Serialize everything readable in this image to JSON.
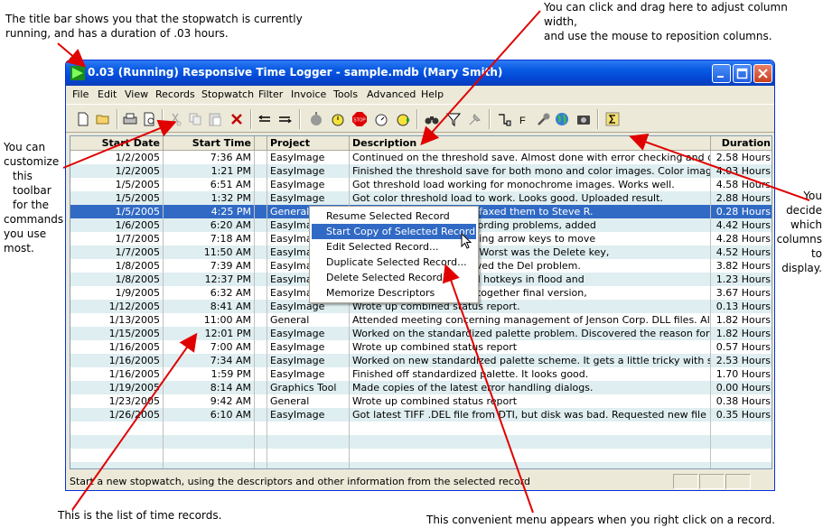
{
  "callouts": {
    "title_bar": [
      "The title bar shows you that the stopwatch is currently",
      "running, and has a duration of .03 hours."
    ],
    "columns_drag": [
      "You can click and drag here to adjust column width,",
      "and use the mouse to reposition columns."
    ],
    "toolbar": [
      "You can",
      "customize",
      "this",
      "toolbar",
      "for the",
      "commands",
      "you use",
      "most."
    ],
    "columns_display": [
      "You",
      "decide",
      "which",
      "columns",
      "to",
      "display."
    ],
    "list": "This is the list of time records.",
    "menu": "This convenient menu appears when you right click on a record."
  },
  "window": {
    "title": "0.03 (Running) Responsive Time Logger - sample.mdb (Mary Smith)"
  },
  "menu": [
    "File",
    "Edit",
    "View",
    "Records",
    "Stopwatch",
    "Filter",
    "Invoice",
    "Tools",
    "Advanced",
    "Help"
  ],
  "columns": [
    "Start Date",
    "Start Time",
    "Project",
    "Description",
    "Duration"
  ],
  "rows": [
    {
      "date": "1/2/2005",
      "time": "7:36 AM",
      "project": "EasyImage",
      "desc": "Continued on the threshold save.  Almost done with error checking and dialog",
      "dur": "2.58 Hours"
    },
    {
      "date": "1/2/2005",
      "time": "1:21 PM",
      "project": "EasyImage",
      "desc": "Finished the threshold save for both mono and color images.  Color image stuff",
      "dur": "4.03 Hours"
    },
    {
      "date": "1/5/2005",
      "time": "6:51 AM",
      "project": "EasyImage",
      "desc": "Got threshold load working for monochrome images.  Works well.",
      "dur": "4.58 Hours"
    },
    {
      "date": "1/5/2005",
      "time": "1:32 PM",
      "project": "EasyImage",
      "desc": "Got color threshold load to work.  Looks good.  Uploaded result.",
      "dur": "2.88 Hours"
    },
    {
      "date": "1/5/2005",
      "time": "4:25 PM",
      "project": "General",
      "desc": "ments on error handling, faxed them to Steve R.",
      "dur": "0.28 Hours"
    },
    {
      "date": "1/6/2005",
      "time": "6:20 AM",
      "project": "EasyImag",
      "desc": "changes, fixed macro recording problems, added",
      "dur": "4.42 Hours"
    },
    {
      "date": "1/7/2005",
      "time": "7:18 AM",
      "project": "EasyImag",
      "desc": "s for keyboard mouse: Using arrow keys to move",
      "dur": "4.28 Hours"
    },
    {
      "date": "1/7/2005",
      "time": "11:50 AM",
      "project": "EasyImag",
      "desc": "yboard mouse problems.  Worst was the Delete key,",
      "dur": "4.52 Hours"
    },
    {
      "date": "1/8/2005",
      "time": "7:39 AM",
      "project": "EasyImag",
      "desc": "problem.  Still haven't solved the Del problem.",
      "dur": "3.82 Hours"
    },
    {
      "date": "1/8/2005",
      "time": "12:37 PM",
      "project": "EasyImag",
      "desc": "mouse presence.  Modifed hotkeys in flood and",
      "dur": "1.23 Hours"
    },
    {
      "date": "1/9/2005",
      "time": "6:32 AM",
      "project": "EasyImag",
      "desc": "board mouse issues.  Put together final version,",
      "dur": "3.67 Hours"
    },
    {
      "date": "1/12/2005",
      "time": "8:41 AM",
      "project": "EasyImage",
      "desc": "Wrote up combined status report.",
      "dur": "0.13 Hours"
    },
    {
      "date": "1/13/2005",
      "time": "11:00 AM",
      "project": "General",
      "desc": "Attended meeting concerning management of Jenson Corp. DLL files.  Also",
      "dur": "1.82 Hours"
    },
    {
      "date": "1/15/2005",
      "time": "12:01 PM",
      "project": "EasyImage",
      "desc": "Worked on the standardized palette problem.  Discovered the reason for it,",
      "dur": "1.82 Hours"
    },
    {
      "date": "1/16/2005",
      "time": "7:00 AM",
      "project": "EasyImage",
      "desc": "Wrote up combined status report",
      "dur": "0.57 Hours"
    },
    {
      "date": "1/16/2005",
      "time": "7:34 AM",
      "project": "EasyImage",
      "desc": "Worked on new standardized palette scheme.  It gets a little tricky with several",
      "dur": "2.53 Hours"
    },
    {
      "date": "1/16/2005",
      "time": "1:59 PM",
      "project": "EasyImage",
      "desc": "Finished off standardized palette.  It looks good.",
      "dur": "1.70 Hours"
    },
    {
      "date": "1/19/2005",
      "time": "8:14 AM",
      "project": "Graphics Tool",
      "desc": "Made copies of the latest error handling dialogs.",
      "dur": "0.00 Hours"
    },
    {
      "date": "1/23/2005",
      "time": "9:42 AM",
      "project": "General",
      "desc": "Wrote up combined status report",
      "dur": "0.38 Hours"
    },
    {
      "date": "1/26/2005",
      "time": "6:10 AM",
      "project": "EasyImage",
      "desc": "Got latest TIFF .DEL file from DTI, but disk was bad.  Requested new file via BBS.",
      "dur": "0.35 Hours"
    }
  ],
  "context_menu": [
    "Resume Selected Record",
    "Start Copy of Selected Record",
    "Edit Selected Record...",
    "Duplicate Selected Record...",
    "Delete Selected Record",
    "Memorize Descriptors"
  ],
  "status": "Start a new stopwatch, using the descriptors and other information from the selected record",
  "icons": [
    "new-icon",
    "open-icon",
    "print-icon",
    "print-preview-icon",
    "cut-icon",
    "copy-icon",
    "paste-icon",
    "delete-icon",
    "indent-icon",
    "outdent-icon",
    "stopwatch-gray-icon",
    "stopwatch-start-icon",
    "stop-icon",
    "stopwatch-pause-icon",
    "stopwatch-resume-icon",
    "binoculars-icon",
    "filter-icon",
    "pin-icon",
    "report-icon",
    "font-icon",
    "tools-icon",
    "globe-icon",
    "camera-icon",
    "sigma-icon"
  ],
  "colors": {
    "selection": "#316ac5",
    "alt_row": "#dfeef0",
    "title_blue": "#0a5be4"
  }
}
